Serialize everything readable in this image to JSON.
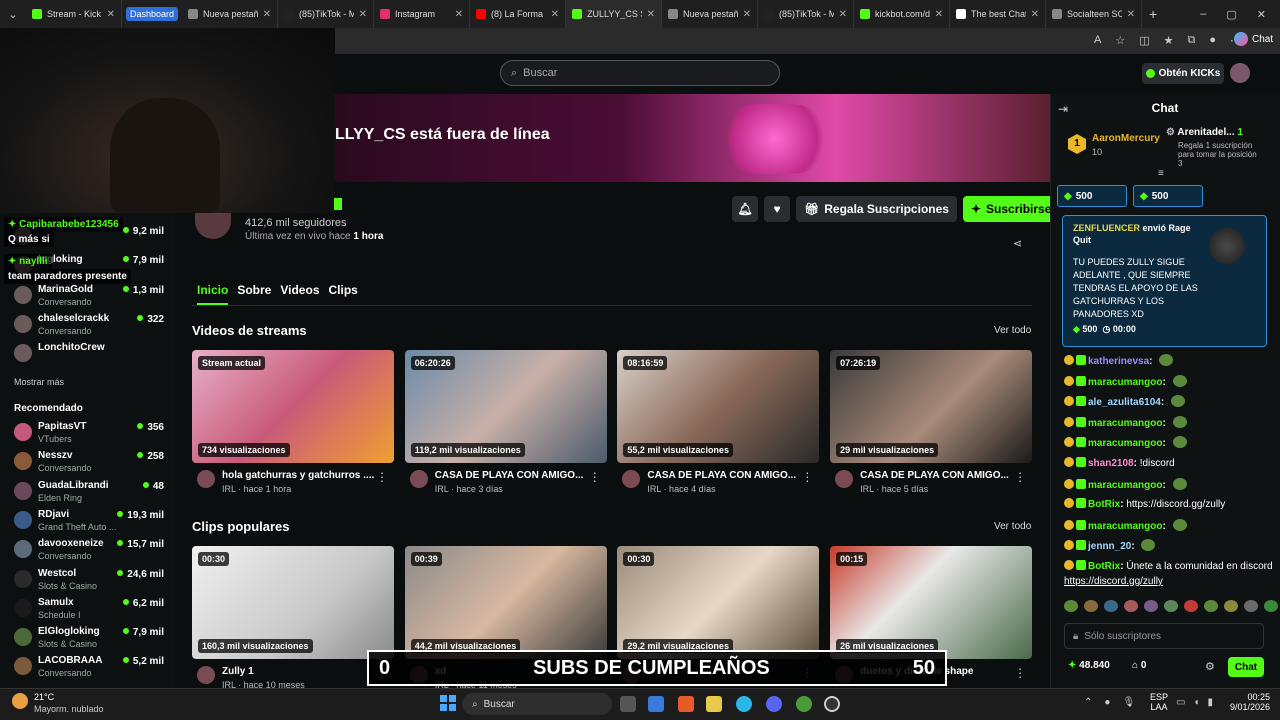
{
  "browser": {
    "tabs": [
      {
        "title": "Stream - Kick D",
        "color": "#53fc18",
        "active": false
      },
      {
        "title": "Nueva pestaña",
        "color": "#888888",
        "active": false
      },
      {
        "title": "(85)TikTok - Ma",
        "color": "#222222",
        "active": false
      },
      {
        "title": "Instagram",
        "color": "#e1306c",
        "active": false
      },
      {
        "title": "(8) La Forma En",
        "color": "#ff0000",
        "active": false
      },
      {
        "title": "ZULLYY_CS Strea",
        "color": "#53fc18",
        "active": true
      },
      {
        "title": "Nueva pestaña",
        "color": "#888888",
        "active": false
      },
      {
        "title": "(85)TikTok - Ma",
        "color": "#222222",
        "active": false
      },
      {
        "title": "kickbot.com/da",
        "color": "#53fc18",
        "active": false
      },
      {
        "title": "The best ChatB",
        "color": "#ffffff",
        "active": false
      },
      {
        "title": "Socialteen SOC",
        "color": "#888888",
        "active": false
      }
    ],
    "dashboard_label": "Dashboard",
    "chat_button": "Chat"
  },
  "header": {
    "search_placeholder": "Buscar",
    "get_kicks": "Obtén KICKs"
  },
  "banner": {
    "offline_text": "LLYY_CS está fuera de línea"
  },
  "channel": {
    "followers": "412,6 mil seguidores",
    "last_live_prefix": "Última vez en vivo hace",
    "last_live_value": "1 hora",
    "gift_subs": "Regala Suscripciones",
    "subscribe": "Suscribirse",
    "tabs": [
      "Inicio",
      "Sobre",
      "Videos",
      "Clips"
    ]
  },
  "overlay_chat": [
    {
      "user": "Capibarabebe123456",
      "text": "Q más si"
    },
    {
      "user": "nayllli",
      "text": "team paradores presente"
    }
  ],
  "sidebar": {
    "following": [
      {
        "name": "",
        "game": "",
        "viewers": "9,2 mil"
      },
      {
        "name": "logloking",
        "game": "",
        "viewers": "7,9 mil"
      },
      {
        "name": "MarinaGold",
        "game": "Conversando",
        "viewers": "1,3 mil"
      },
      {
        "name": "chaleselcrackk",
        "game": "Conversando",
        "viewers": "322"
      },
      {
        "name": "LonchitoCrew",
        "game": "",
        "viewers": ""
      }
    ],
    "show_more": "Mostrar más",
    "recommended_title": "Recomendado",
    "recommended": [
      {
        "name": "PapitasVT",
        "game": "VTubers",
        "viewers": "356",
        "color": "#c45a7a"
      },
      {
        "name": "Nesszv",
        "game": "Conversando",
        "viewers": "258",
        "color": "#8a5a3a"
      },
      {
        "name": "GuadaLibrandi",
        "game": "Elden Ring",
        "viewers": "48",
        "color": "#6a4a5a"
      },
      {
        "name": "RDjavi",
        "game": "Grand Theft Auto ...",
        "viewers": "19,3 mil",
        "color": "#3a5a8a"
      },
      {
        "name": "davooxeneize",
        "game": "Conversando",
        "viewers": "15,7 mil",
        "color": "#5a6a7a"
      },
      {
        "name": "Westcol",
        "game": "Slots & Casino",
        "viewers": "24,6 mil",
        "color": "#2a2a2a"
      },
      {
        "name": "Samulx",
        "game": "Schedule I",
        "viewers": "6,2 mil",
        "color": "#1a1a1a"
      },
      {
        "name": "ElGlogloking",
        "game": "Slots & Casino",
        "viewers": "7,9 mil",
        "color": "#4a6a3a"
      },
      {
        "name": "LACOBRAAA",
        "game": "Conversando",
        "viewers": "5,2 mil",
        "color": "#7a5a3a"
      }
    ]
  },
  "streams": {
    "title": "Videos de streams",
    "see_all": "Ver todo",
    "items": [
      {
        "badge": "Stream actual",
        "views": "734 visualizaciones",
        "title": "hola gatchurras y gatchurros ....",
        "meta": "IRL · hace 1 hora",
        "bg": "linear-gradient(135deg,#e8b0c8,#c85a7a 50%,#f0a030)"
      },
      {
        "badge": "06:20:26",
        "views": "119,2 mil visualizaciones",
        "title": "CASA DE PLAYA CON AMIGO...",
        "meta": "IRL · hace 3 días",
        "bg": "linear-gradient(135deg,#6a8aa8,#c8b0a8 50%,#4a5a6a)"
      },
      {
        "badge": "08:16:59",
        "views": "55,2 mil visualizaciones",
        "title": "CASA DE PLAYA CON AMIGO...",
        "meta": "IRL · hace 4 días",
        "bg": "linear-gradient(135deg,#d8d0c8,#8a6a5a 50%,#2a2a2a)"
      },
      {
        "badge": "07:26:19",
        "views": "29 mil visualizaciones",
        "title": "CASA DE PLAYA CON AMIGO...",
        "meta": "IRL · hace 5 días",
        "bg": "linear-gradient(135deg,#3a3a3a,#a88a7a 55%,#1a1a1a)"
      }
    ]
  },
  "clips": {
    "title": "Clips populares",
    "see_all": "Ver todo",
    "items": [
      {
        "badge": "00:30",
        "views": "160,3 mil visualizaciones",
        "title": "Zully 1",
        "meta": "IRL · hace 10 meses",
        "bg": "linear-gradient(135deg,#f0f0f0,#c8c8c8 60%,#8a8a8a)"
      },
      {
        "badge": "00:39",
        "views": "44,2 mil visualizaciones",
        "title": "xd",
        "meta": "IRL · hace 11 meses",
        "bg": "linear-gradient(135deg,#8a8a8a,#d8b8a0 50%,#3a3a3a)"
      },
      {
        "badge": "00:30",
        "views": "29,2 mil visualizaciones",
        "title": "",
        "meta": "",
        "bg": "linear-gradient(135deg,#9a8a7a,#e8d8c8 50%,#5a4a3a)"
      },
      {
        "badge": "00:15",
        "views": "26 mil visualizaciones",
        "title": "duetos y dieta de shape",
        "meta": "",
        "bg": "linear-gradient(135deg,#c83a2a,#e8e8e8 40%,#4a6a4a)"
      }
    ]
  },
  "chat": {
    "title": "Chat",
    "leaderboard": [
      {
        "rank": "1",
        "name": "AaronMercury",
        "value": "10"
      },
      {
        "rank": "",
        "name": "Arenitadel...",
        "value": "1"
      }
    ],
    "leaderboard_note": "Regala 1 suscripción para tomar la posición 3",
    "goals": [
      "500",
      "500"
    ],
    "pinned": {
      "user": "ZENFLUENCER",
      "action": "envió Rage Quit",
      "message": "TU PUEDES ZULLY SIGUE ADELANTE , QUE SIEMPRE TENDRAS EL APOYO DE LAS GATCHURRAS Y LOS PANADORES XD",
      "amount": "500",
      "time": "00:00"
    },
    "messages": [
      {
        "user": "katherinevsa",
        "text": "",
        "color": "#9b8cff"
      },
      {
        "user": "maracumangoo",
        "text": "",
        "color": "#53fc18"
      },
      {
        "user": "ale_azulita6104",
        "text": "",
        "color": "#9fd8ff"
      },
      {
        "user": "maracumangoo",
        "text": "",
        "color": "#53fc18"
      },
      {
        "user": "maracumangoo",
        "text": "",
        "color": "#53fc18"
      },
      {
        "user": "shan2108",
        "text": "!discord",
        "color": "#ff8ad0"
      },
      {
        "user": "maracumangoo",
        "text": "",
        "color": "#53fc18"
      },
      {
        "user": "BotRix",
        "text": "https://discord.gg/zully",
        "color": "#53fc18"
      },
      {
        "user": "maracumangoo",
        "text": "",
        "color": "#53fc18"
      },
      {
        "user": "jennn_20",
        "text": "",
        "color": "#9fd8ff"
      },
      {
        "user": "BotRix",
        "text": "Únete a la comunidad en discord",
        "color": "#53fc18"
      }
    ],
    "last_line": "https://discord.gg/zully",
    "input_placeholder": "Sólo suscriptores",
    "points": "48.840",
    "gift_count": "0",
    "send": "Chat"
  },
  "birthday_bar": {
    "left": "0",
    "text": "SUBS DE CUMPLEAÑOS",
    "right": "50"
  },
  "taskbar": {
    "weather_temp": "21°C",
    "weather_desc": "Mayorm. nublado",
    "search": "Buscar",
    "lang": "ESP",
    "lang2": "LAA",
    "time": "00:25",
    "date": "9/01/2026"
  }
}
